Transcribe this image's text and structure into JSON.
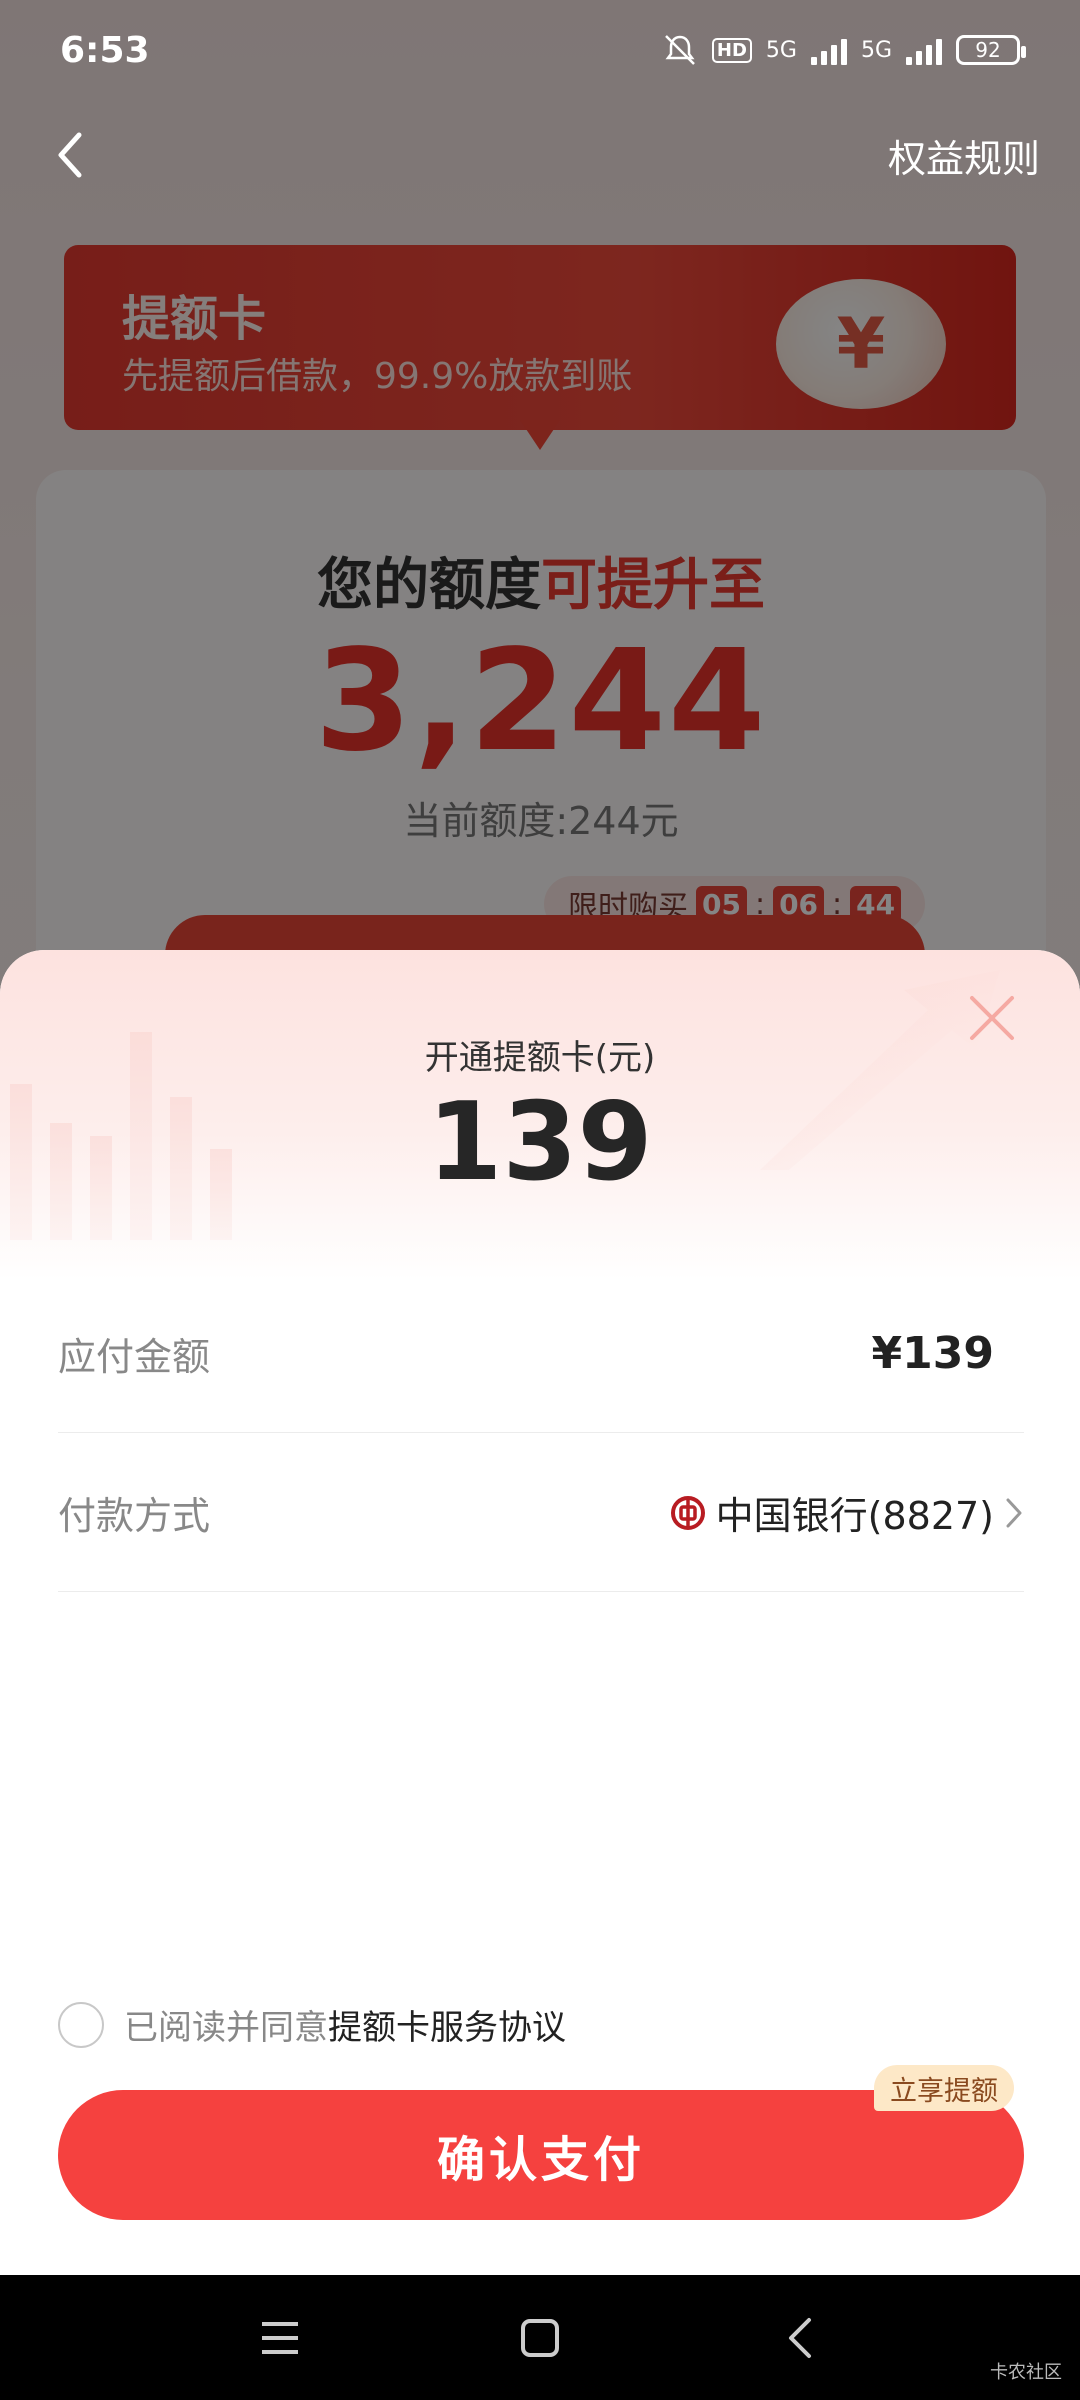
{
  "status_bar": {
    "time": "6:53",
    "hd_label": "HD",
    "network_1": "5G",
    "network_2": "5G",
    "battery": "92"
  },
  "nav": {
    "back_icon": "chevron-left-icon",
    "rules_label": "权益规则"
  },
  "banner": {
    "title": "提额卡",
    "subtitle": "先提额后借款，99.9%放款到账",
    "coin_symbol": "¥"
  },
  "quota": {
    "title_prefix": "您的额度",
    "title_highlight": "可提升至",
    "value": "3,244",
    "current": "当前额度:244元",
    "limit_label": "限时购买",
    "countdown": [
      "05",
      "06",
      "44"
    ],
    "countdown_sep": ":"
  },
  "sheet": {
    "label": "开通提额卡(元)",
    "amount": "139",
    "rows": {
      "payable_label": "应付金额",
      "payable_value": "¥139",
      "method_label": "付款方式",
      "method_value": "中国银行(8827)"
    },
    "agreement_prefix": "已阅读并同意",
    "agreement_link": "提额卡服务协议",
    "confirm_label": "确认支付",
    "promo_badge": "立享提额"
  },
  "watermark": "卡农社区",
  "colors": {
    "accent": "#f5413f",
    "quota_red": "#e8322b",
    "boc_red": "#b81c22"
  }
}
